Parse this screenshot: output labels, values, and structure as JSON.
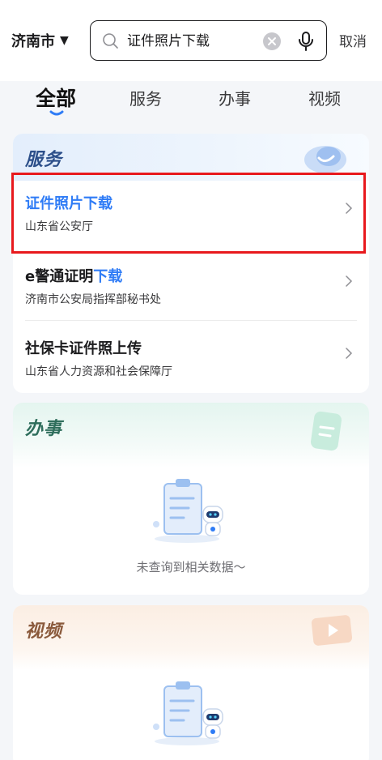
{
  "header": {
    "city": "济南市",
    "city_caret": "▼",
    "search_query": "证件照片下载",
    "cancel_label": "取消"
  },
  "tabs": [
    {
      "label": "全部",
      "active": true
    },
    {
      "label": "服务",
      "active": false
    },
    {
      "label": "办事",
      "active": false
    },
    {
      "label": "视频",
      "active": false
    }
  ],
  "services": {
    "title": "服务",
    "items": [
      {
        "title_plain": "",
        "title_highlight": "证件照片下载",
        "subtitle": "山东省公安厅"
      },
      {
        "title_plain": "e警通证明",
        "title_highlight": "下载",
        "subtitle": "济南市公安局指挥部秘书处"
      },
      {
        "title_plain": "社保卡证件照上传",
        "title_highlight": "",
        "subtitle": "山东省人力资源和社会保障厅"
      }
    ]
  },
  "affairs": {
    "title": "办事",
    "empty_text": "未查询到相关数据～"
  },
  "videos": {
    "title": "视频"
  },
  "colors": {
    "accent": "#2f7cf6",
    "highlight_border": "#e8191d",
    "services_title": "#2c4f8a",
    "affairs_title": "#2f6e5c",
    "videos_title": "#8a5a3c"
  }
}
